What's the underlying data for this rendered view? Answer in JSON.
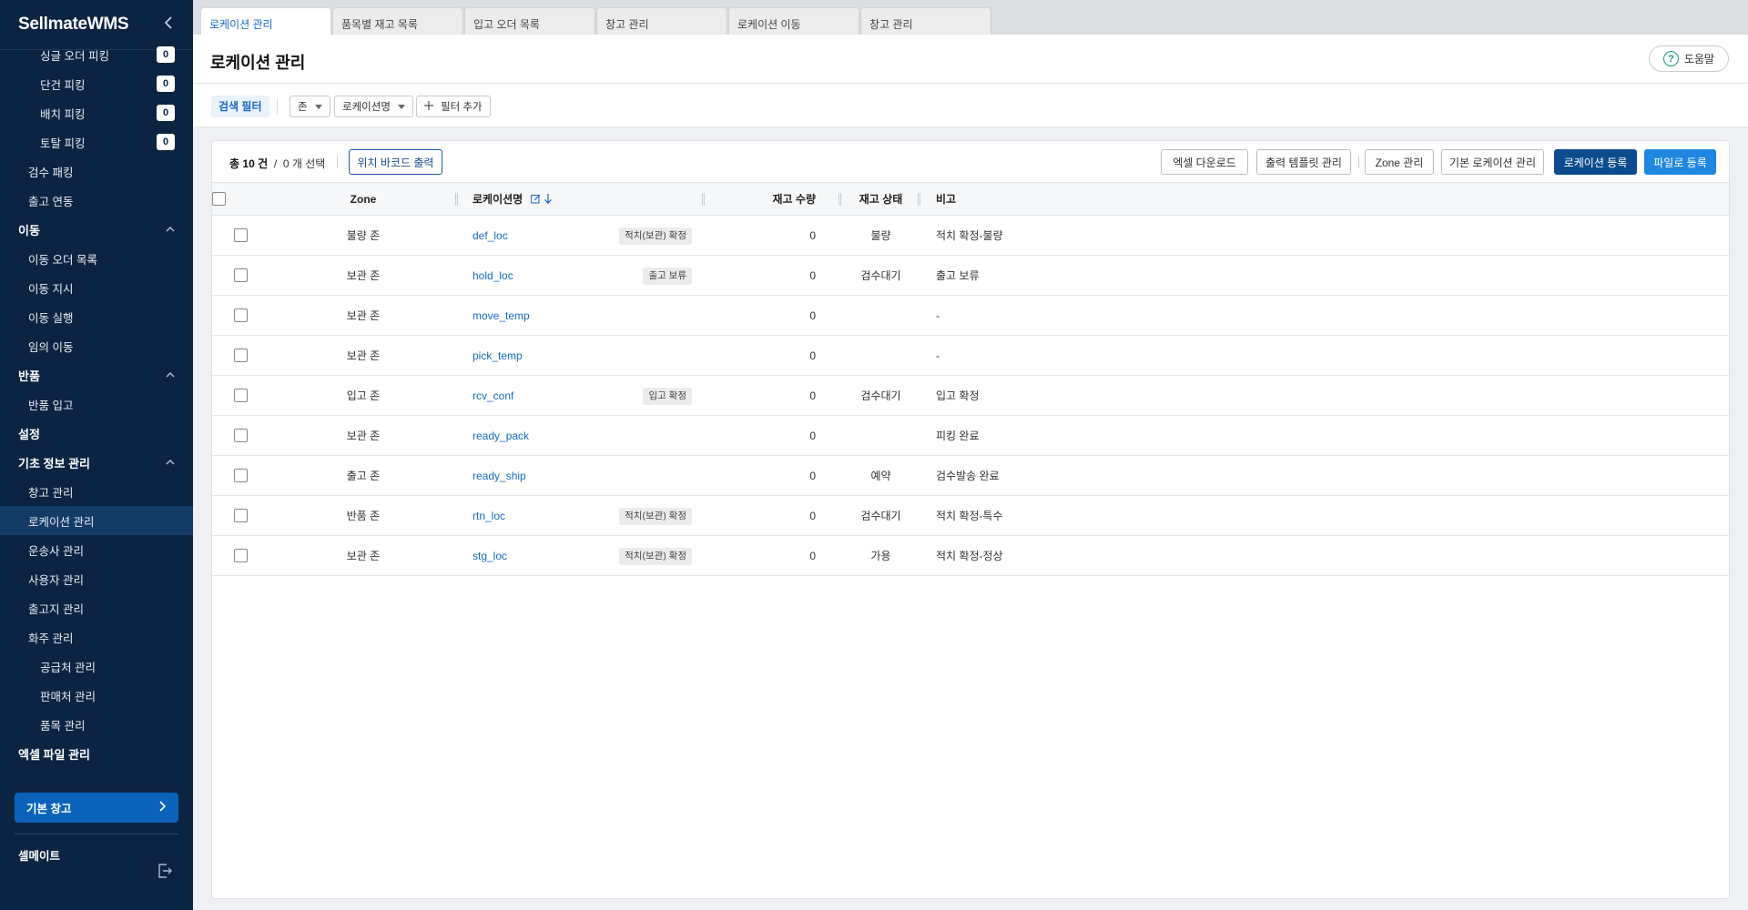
{
  "sidebar": {
    "logo_main": "Sellmate",
    "logo_sub": "WMS",
    "items": [
      {
        "label": "싱글 오더 피킹",
        "level": 2,
        "count": "0"
      },
      {
        "label": "단건 피킹",
        "level": 2,
        "count": "0"
      },
      {
        "label": "배치 피킹",
        "level": 2,
        "count": "0"
      },
      {
        "label": "토탈 피킹",
        "level": 2,
        "count": "0"
      },
      {
        "label": "검수 패킹",
        "level": 1
      },
      {
        "label": "출고 연동",
        "level": 1
      },
      {
        "label": "이동",
        "level": 0,
        "expanded": true
      },
      {
        "label": "이동 오더 목록",
        "level": 1
      },
      {
        "label": "이동 지시",
        "level": 1
      },
      {
        "label": "이동 실행",
        "level": 1
      },
      {
        "label": "임의 이동",
        "level": 1
      },
      {
        "label": "반품",
        "level": 0,
        "expanded": true
      },
      {
        "label": "반품 입고",
        "level": 1
      },
      {
        "label": "설정",
        "level": 0
      },
      {
        "label": "기초 정보 관리",
        "level": 0,
        "expanded": true
      },
      {
        "label": "창고 관리",
        "level": 1
      },
      {
        "label": "로케이션 관리",
        "level": 1,
        "active": true
      },
      {
        "label": "운송사 관리",
        "level": 1
      },
      {
        "label": "사용자 관리",
        "level": 1
      },
      {
        "label": "출고지 관리",
        "level": 1
      },
      {
        "label": "화주 관리",
        "level": 1
      },
      {
        "label": "공급처 관리",
        "level": 2
      },
      {
        "label": "판매처 관리",
        "level": 2
      },
      {
        "label": "품목 관리",
        "level": 2
      },
      {
        "label": "엑셀 파일 관리",
        "level": 0
      }
    ],
    "warehouse_button": "기본 창고",
    "company": "셀메이트"
  },
  "tabs": [
    {
      "label": "로케이션 관리",
      "active": true
    },
    {
      "label": "품목별 재고 목록"
    },
    {
      "label": "입고 오더 목록"
    },
    {
      "label": "창고 관리"
    },
    {
      "label": "로케이션 이동"
    },
    {
      "label": "창고 관리"
    }
  ],
  "page": {
    "title": "로케이션 관리",
    "help_label": "도움말"
  },
  "filters": {
    "label": "검색 필터",
    "zone_select": "존",
    "location_select": "로케이션명",
    "add_filter": "필터 추가"
  },
  "toolbar": {
    "total_prefix": "총",
    "total_count": "10",
    "total_unit": "건",
    "separator": "/",
    "selected_count": "0",
    "selected_suffix": "개 선택",
    "barcode_button": "위치 바코드 출력",
    "excel_download": "엑셀 다운로드",
    "template_manage": "출력 템플릿 관리",
    "zone_manage": "Zone 관리",
    "default_location": "기본 로케이션 관리",
    "register_location": "로케이션 등록",
    "register_file": "파일로 등록"
  },
  "table": {
    "headers": {
      "zone": "Zone",
      "location": "로케이션명",
      "qty": "재고 수량",
      "status": "재고 상태",
      "note": "비고"
    },
    "rows": [
      {
        "zone": "불량 존",
        "location": "def_loc",
        "tag": "적치(보관) 확정",
        "qty": "0",
        "status": "불량",
        "note": "적치 확정-불량"
      },
      {
        "zone": "보관 존",
        "location": "hold_loc",
        "tag": "출고 보류",
        "qty": "0",
        "status": "검수대기",
        "note": "출고 보류"
      },
      {
        "zone": "보관 존",
        "location": "move_temp",
        "tag": "",
        "qty": "0",
        "status": "",
        "note": "-"
      },
      {
        "zone": "보관 존",
        "location": "pick_temp",
        "tag": "",
        "qty": "0",
        "status": "",
        "note": "-"
      },
      {
        "zone": "입고 존",
        "location": "rcv_conf",
        "tag": "입고 확정",
        "qty": "0",
        "status": "검수대기",
        "note": "입고 확정"
      },
      {
        "zone": "보관 존",
        "location": "ready_pack",
        "tag": "",
        "qty": "0",
        "status": "",
        "note": "피킹 완료"
      },
      {
        "zone": "출고 존",
        "location": "ready_ship",
        "tag": "",
        "qty": "0",
        "status": "예약",
        "note": "검수발송 완료"
      },
      {
        "zone": "반품 존",
        "location": "rtn_loc",
        "tag": "적치(보관) 확정",
        "qty": "0",
        "status": "검수대기",
        "note": "적치 확정-특수"
      },
      {
        "zone": "보관 존",
        "location": "stg_loc",
        "tag": "적치(보관) 확정",
        "qty": "0",
        "status": "가용",
        "note": "적치 확정-정상"
      }
    ]
  },
  "colors": {
    "sidebar_bg": "#0b2442",
    "accent_blue": "#1769c4",
    "navy_button": "#0c4c8e",
    "blue_button": "#1f87e0",
    "help_green": "#16a06b"
  },
  "icons": {
    "collapse": "chevron-left-icon",
    "section_toggle": "chevron-up-icon",
    "help": "question-circle-icon",
    "logout": "logout-icon",
    "edit": "edit-icon",
    "sort": "arrow-down-icon",
    "add": "plus-icon"
  }
}
